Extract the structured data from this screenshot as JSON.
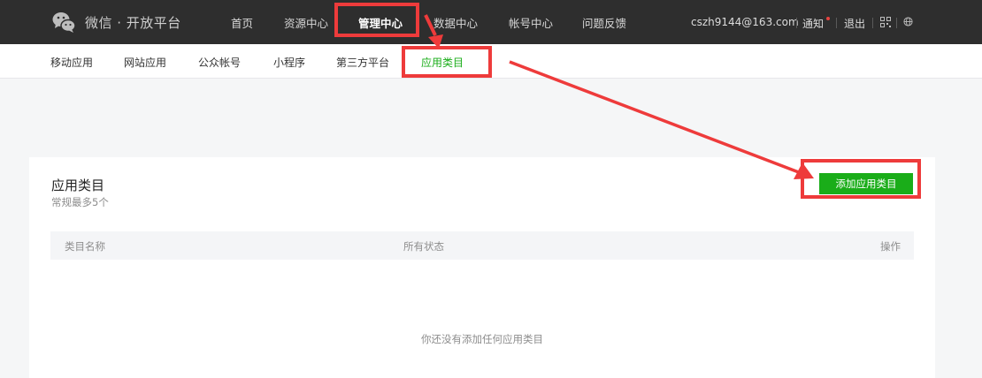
{
  "header": {
    "brand": "微信 · 开放平台",
    "nav": [
      {
        "label": "首页",
        "active": false
      },
      {
        "label": "资源中心",
        "active": false
      },
      {
        "label": "管理中心",
        "active": true
      },
      {
        "label": "数据中心",
        "active": false
      },
      {
        "label": "帐号中心",
        "active": false
      },
      {
        "label": "问题反馈",
        "active": false
      }
    ],
    "user_email": "cszh9144@163.com",
    "notify_label": "通知",
    "logout_label": "退出",
    "qr_icon": "qrcode-icon",
    "globe_icon": "globe-icon"
  },
  "subnav": {
    "items": [
      {
        "label": "移动应用",
        "active": false
      },
      {
        "label": "网站应用",
        "active": false
      },
      {
        "label": "公众帐号",
        "active": false
      },
      {
        "label": "小程序",
        "active": false
      },
      {
        "label": "第三方平台",
        "active": false
      },
      {
        "label": "应用类目",
        "active": true
      }
    ]
  },
  "panel": {
    "title": "应用类目",
    "subtitle": "常规最多5个",
    "add_button": "添加应用类目",
    "columns": [
      "类目名称",
      "所有状态",
      "操作"
    ],
    "empty_text": "你还没有添加任何应用类目"
  },
  "colors": {
    "topbar": "#2e2e2e",
    "accent_green": "#1aad19",
    "annotation_red": "#ee3b3b"
  }
}
